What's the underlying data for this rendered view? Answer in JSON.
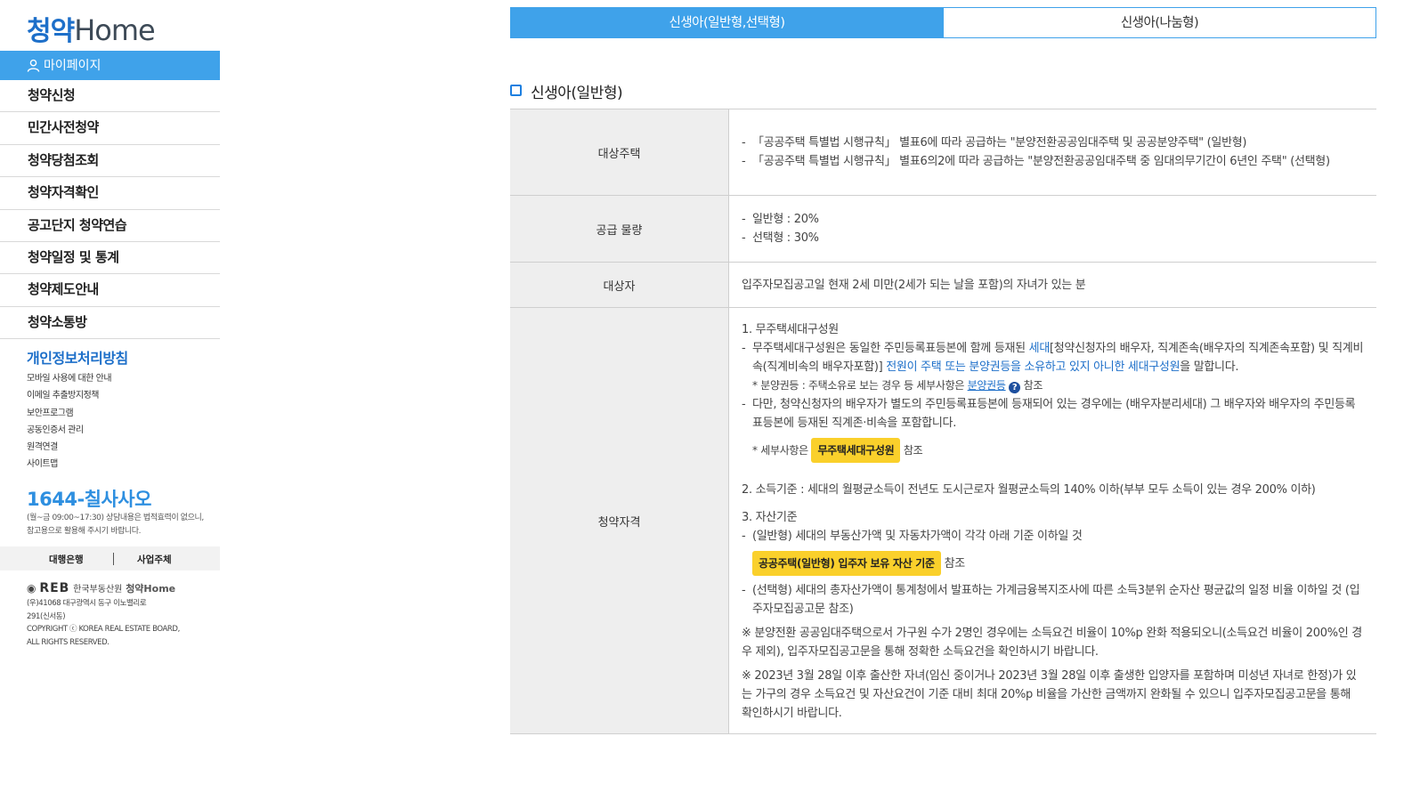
{
  "sidebar": {
    "logo_ko": "청약",
    "logo_en": "Home",
    "mypage_label": "마이페이지",
    "menu": [
      "청약신청",
      "민간사전청약",
      "청약당첨조회",
      "청약자격확인",
      "공고단지 청약연습",
      "청약일정 및 통계",
      "청약제도안내",
      "청약소통방"
    ],
    "privacy_label": "개인정보처리방침",
    "sublinks": [
      "모바일 사용에 대한 안내",
      "이메일 추출방지정책",
      "보안프로그램",
      "공동인증서 관리",
      "원격연결",
      "사이트맵"
    ],
    "phone": "1644-칠사사오",
    "phone_note": "(월~금 09:00~17:30) 상담내용은 법적효력이 없으니, 참고용으로 활용해 주시기 바랍니다.",
    "partner_bank": "대행은행",
    "partner_biz": "사업주체",
    "footer_reb": "REB",
    "footer_org": "한국부동산원",
    "footer_brand": "청약Home",
    "footer_address_1": "(우)41068 대구광역시 동구 이노밸리로",
    "footer_address_2": "291(신서동)",
    "footer_copyright_1": "COPYRIGHT ⓒ KOREA REAL ESTATE BOARD,",
    "footer_copyright_2": "ALL RIGHTS RESERVED."
  },
  "tabs": [
    {
      "label": "신생아(일반형,선택형)",
      "active": true
    },
    {
      "label": "신생아(나눔형)",
      "active": false
    }
  ],
  "section_title": "신생아(일반형)",
  "table": {
    "target_housing": {
      "header": "대상주택",
      "line1": "「공공주택 특별법 시행규칙」 별표6에 따라 공급하는 \"분양전환공공임대주택 및 공공분양주택\" (일반형)",
      "line2": "「공공주택 특별법 시행규칙」 별표6의2에 따라 공급하는 \"분양전환공공임대주택 중 임대의무기간이 6년인 주택\" (선택형)"
    },
    "supply": {
      "header": "공급 물량",
      "line1": "일반형 : 20%",
      "line2": "선택형 : 30%"
    },
    "target": {
      "header": "대상자",
      "text": "입주자모집공고일 현재 2세 미만(2세가 되는 날을 포함)의 자녀가 있는 분"
    },
    "qualification": {
      "header": "청약자격",
      "s1_title": "1. 무주택세대구성원",
      "s1_a_1": "무주택세대구성원은 동일한 주민등록표등본에 함께 등재된 ",
      "s1_a_blue1": "세대",
      "s1_a_2": "[청약신청자의 배우자, 직계존속(배우자의 직계존속포함) 및 직계비속(직계비속의 배우자포함)] ",
      "s1_a_blue2": "전원이 주택 또는 분양권등을 소유하고 있지 아니한 세대구성원",
      "s1_a_3": "을 말합니다.",
      "s1_note_1": "* 분양권등 : 주택소유로 보는 경우 등 세부사항은 ",
      "s1_note_link": "분양권등",
      "s1_note_q": "?",
      "s1_note_2": " 참조",
      "s1_b": "다만, 청약신청자의 배우자가 별도의 주민등록표등본에 등재되어 있는 경우에는 (배우자분리세대) 그 배우자와 배우자의 주민등록표등본에 등재된 직계존·비속을 포함합니다.",
      "s1_detail_1": "* 세부사항은",
      "s1_detail_btn": "무주택세대구성원",
      "s1_detail_2": "참조",
      "s2": "2. 소득기준 : 세대의 월평균소득이 전년도 도시근로자 월평균소득의 140% 이하(부부 모두 소득이 있는 경우 200% 이하)",
      "s3_title": "3. 자산기준",
      "s3_a": "(일반형) 세대의 부동산가액 및 자동차가액이 각각 아래 기준 이하일 것",
      "s3_btn": "공공주택(일반형) 입주자 보유 자산 기준",
      "s3_btn_after": "참조",
      "s3_b": "(선택형) 세대의 총자산가액이 통계청에서 발표하는 가계금융복지조사에 따른 소득3분위 순자산 평균값의 일정 비율 이하일 것 (입주자모집공고문 참조)",
      "note1": "※ 분양전환 공공임대주택으로서 가구원 수가 2명인 경우에는 소득요건 비율이 10%p 완화 적용되오니(소득요건 비율이 200%인 경우 제외), 입주자모집공고문을 통해 정확한 소득요건을 확인하시기 바랍니다.",
      "note2": "※ 2023년 3월 28일 이후 출산한 자녀(임신 중이거나 2023년 3월 28일 이후 출생한 입양자를 포함하며 미성년 자녀로 한정)가 있는 가구의 경우 소득요건 및 자산요건이 기준 대비 최대 20%p 비율을 가산한 금액까지 완화될 수 있으니 입주자모집공고문을 통해 확인하시기 바랍니다."
    }
  },
  "colors": {
    "accent": "#3fa2ea",
    "brand_blue": "#1d6fc9",
    "highlight_yellow": "#fad02b"
  },
  "icons": [
    "user-icon",
    "question-icon",
    "reb-logo-icon"
  ]
}
